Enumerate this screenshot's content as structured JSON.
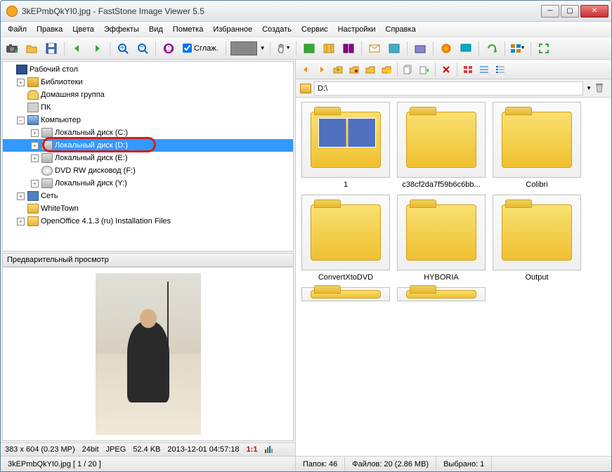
{
  "title": "3kEPmbQkYI0.jpg  -  FastStone Image Viewer 5.5",
  "menu": [
    "Файл",
    "Правка",
    "Цвета",
    "Эффекты",
    "Вид",
    "Пометка",
    "Избранное",
    "Создать",
    "Сервис",
    "Настройки",
    "Справка"
  ],
  "smooth_label": "Сглаж.",
  "tree": {
    "desktop": "Рабочий стол",
    "libs": "Библиотеки",
    "home": "Домашняя группа",
    "pc": "ПК",
    "computer": "Компьютер",
    "disk_c": "Локальный диск (C:)",
    "disk_d": "Локальный диск (D:)",
    "disk_e": "Локальный диск (E:)",
    "dvd": "DVD RW дисковод (F:)",
    "disk_y": "Локальный диск (Y:)",
    "net": "Сеть",
    "whitetown": "WhiteTown",
    "openoffice": "OpenOffice 4.1.3 (ru) Installation Files"
  },
  "preview_header": "Предварительный просмотр",
  "image_info": {
    "dims": "383 x 604 (0.23 MP)",
    "depth": "24bit",
    "format": "JPEG",
    "size": "52.4 KB",
    "date": "2013-12-01 04:57:18",
    "ratio": "1:1"
  },
  "path": "D:\\",
  "folders": [
    {
      "name": "1",
      "has_thumbs": true
    },
    {
      "name": "c38cf2da7f59b6c6bb...",
      "has_thumbs": false
    },
    {
      "name": "Colibri",
      "has_thumbs": false
    },
    {
      "name": "ConvertXtoDVD",
      "has_thumbs": false
    },
    {
      "name": "HYBORIA",
      "has_thumbs": false
    },
    {
      "name": "Output",
      "has_thumbs": false
    }
  ],
  "status": {
    "filename": "3kEPmbQkYI0.jpg [ 1 / 20 ]",
    "folders": "Папок: 46",
    "files": "Файлов: 20 (2.86 MB)",
    "selected": "Выбрано: 1"
  }
}
